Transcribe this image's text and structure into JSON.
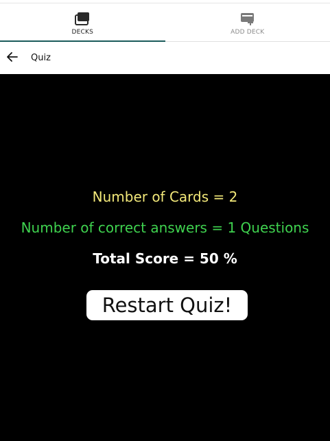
{
  "tabs": [
    {
      "label": "DECKS",
      "icon": "decks-icon",
      "active": true
    },
    {
      "label": "ADD DECK",
      "icon": "add-deck-icon",
      "active": false
    }
  ],
  "header": {
    "title": "Quiz",
    "back_icon": "arrow-left-icon"
  },
  "results": {
    "cards_text": "Number of Cards = 2",
    "correct_text": "Number of correct answers = 1 Questions",
    "score_text": "Total Score = 50 %"
  },
  "actions": {
    "restart_label": "Restart Quiz!"
  },
  "colors": {
    "cards": "#f3e97a",
    "correct": "#3fd24f",
    "score": "#ffffff",
    "background": "#000000",
    "tab_indicator": "#1a5a5a"
  }
}
